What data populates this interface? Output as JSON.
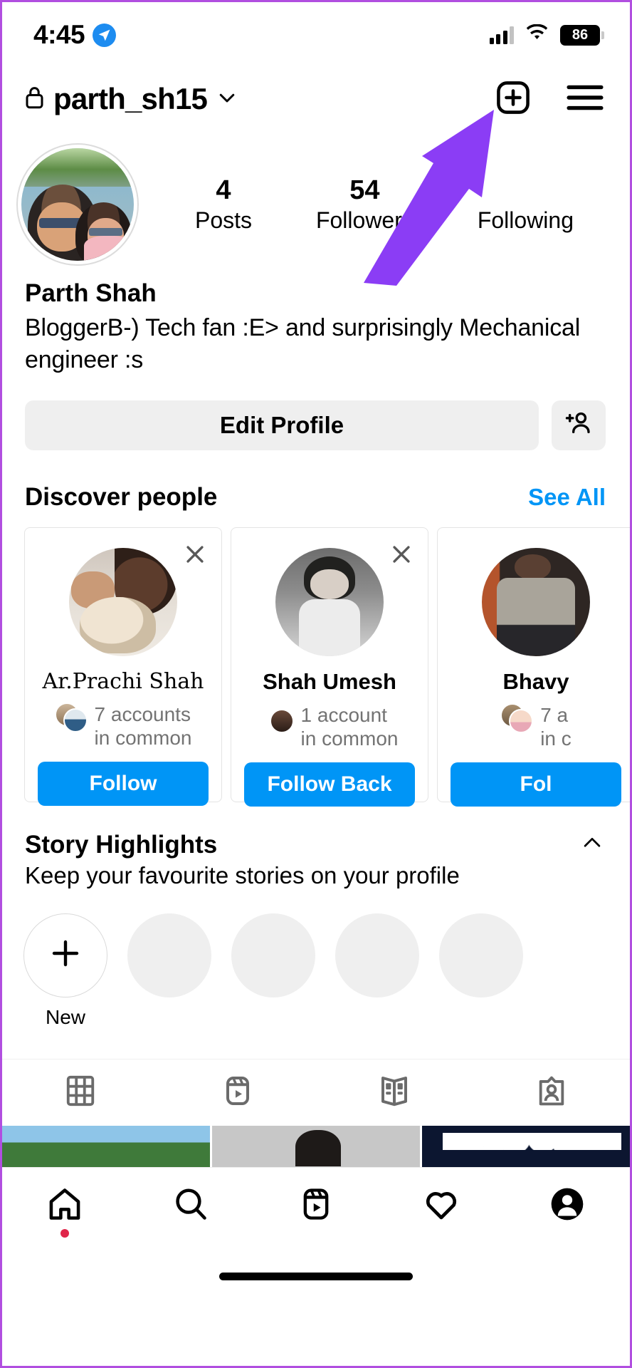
{
  "status_bar": {
    "time": "4:45",
    "location_icon": "location-arrow-icon",
    "cellular_icon": "cellular-bars-icon",
    "wifi_icon": "wifi-icon",
    "battery_level": "86"
  },
  "header": {
    "lock_icon": "lock-icon",
    "username": "parth_sh15",
    "chevron_icon": "chevron-down-icon",
    "add_icon": "plus-square-icon",
    "menu_icon": "hamburger-menu-icon"
  },
  "profile": {
    "avatar_name": "profile-picture",
    "display_name": "Parth Shah",
    "bio": "BloggerB-) Tech fan :E> and surprisingly Mechanical engineer :s",
    "stats": [
      {
        "value": "4",
        "label": "Posts"
      },
      {
        "value": "54",
        "label": "Followers"
      },
      {
        "value": "",
        "label": "Following"
      }
    ]
  },
  "actions": {
    "edit_profile_label": "Edit Profile",
    "add_user_icon": "add-person-icon"
  },
  "discover": {
    "title": "Discover people",
    "see_all_label": "See All",
    "close_icon": "close-icon",
    "cards": [
      {
        "name": "Ar.Prachi Shah",
        "common_line1": "7 accounts",
        "common_line2": "in common",
        "button_label": "Follow"
      },
      {
        "name": "Shah Umesh",
        "common_line1": "1 account",
        "common_line2": "in common",
        "button_label": "Follow Back"
      },
      {
        "name": "Bhavy",
        "common_line1": "7 a",
        "common_line2": "in c",
        "button_label": "Fol"
      }
    ]
  },
  "highlights": {
    "title": "Story Highlights",
    "subtitle": "Keep your favourite stories on your profile",
    "collapse_icon": "chevron-up-icon",
    "new_label": "New",
    "plus_icon": "plus-icon",
    "placeholder_count": 4
  },
  "content_tabs": [
    {
      "icon": "grid-icon"
    },
    {
      "icon": "reels-icon"
    },
    {
      "icon": "guides-icon"
    },
    {
      "icon": "tagged-icon"
    }
  ],
  "bottom_nav": [
    {
      "icon": "home-icon",
      "badge": true
    },
    {
      "icon": "search-icon",
      "badge": false
    },
    {
      "icon": "reels-icon",
      "badge": false
    },
    {
      "icon": "heart-icon",
      "badge": false
    },
    {
      "icon": "profile-avatar-icon",
      "badge": false
    }
  ],
  "annotation": {
    "arrow_icon": "pointer-arrow-annotation",
    "color": "#8B3DF5"
  },
  "colors": {
    "accent_blue": "#0095F6",
    "link_blue": "#0095F6",
    "button_grey": "#EFEFEF",
    "muted_text": "#737373",
    "badge_red": "#E0264A",
    "frame_purple": "#B14EE0"
  }
}
